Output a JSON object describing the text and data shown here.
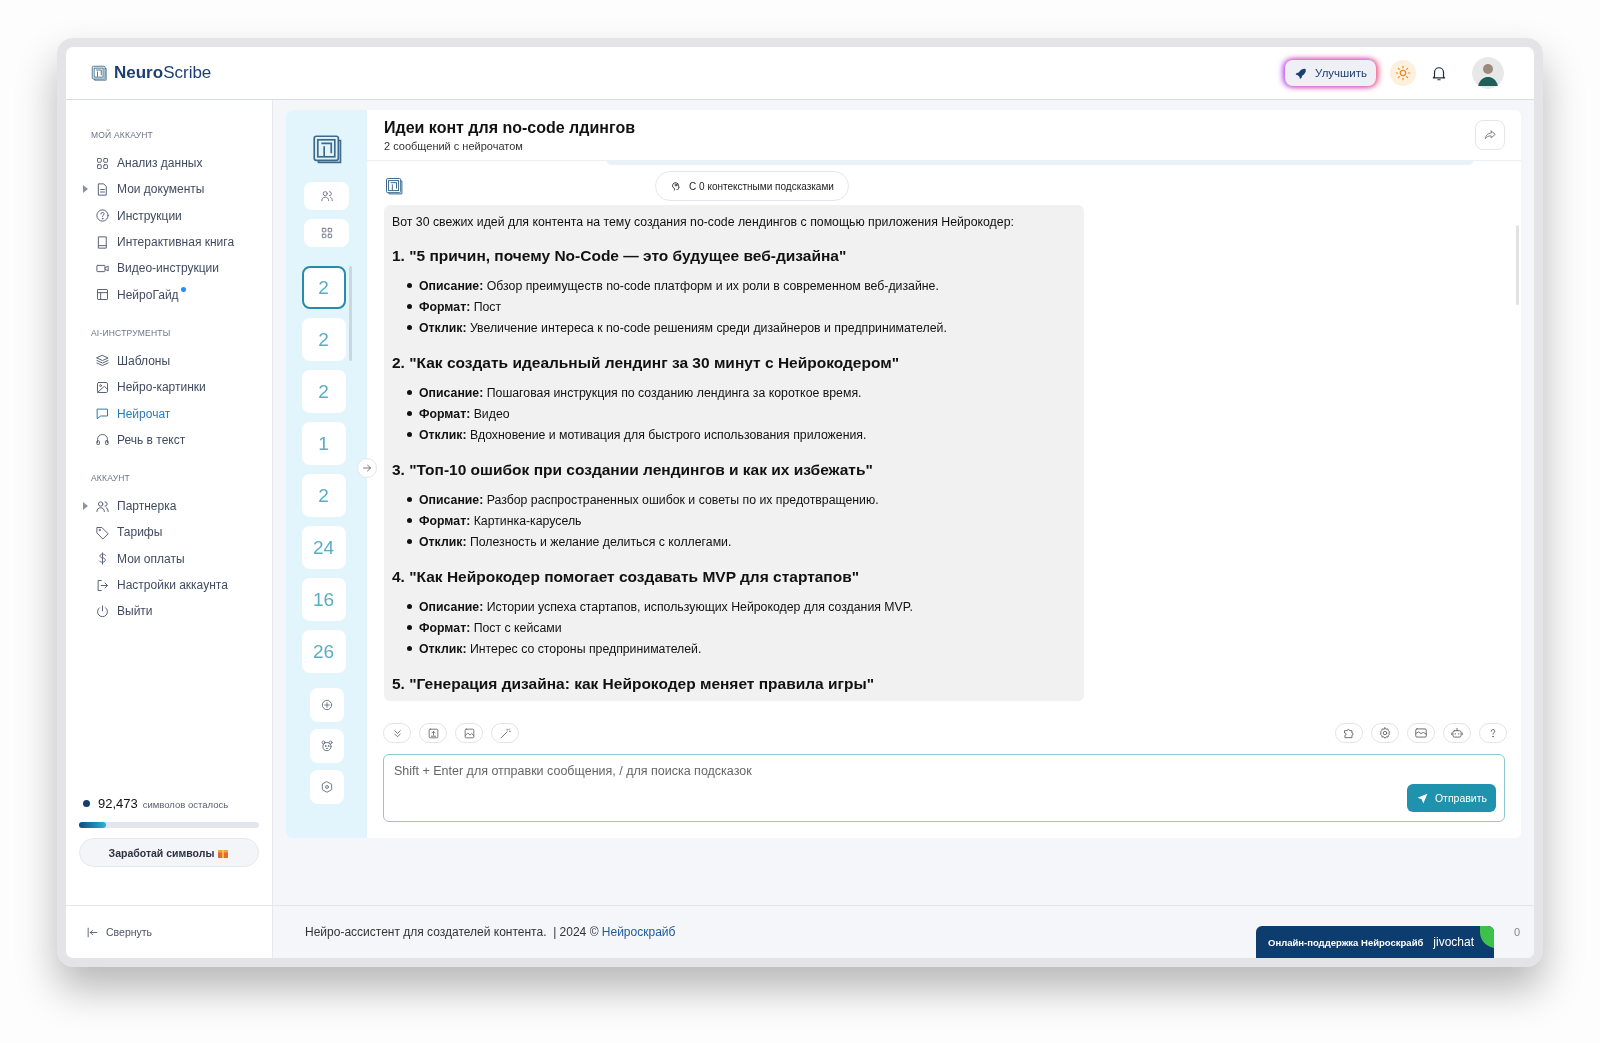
{
  "header": {
    "logo_bold": "Neuro",
    "logo_light": "Scribe",
    "upgrade_button": "Улучшить"
  },
  "sidebar": {
    "sections": [
      {
        "title": "МОЙ АККАУНТ",
        "items": [
          {
            "label": "Анализ данных",
            "expandable": false,
            "selected": false,
            "new_dot": false
          },
          {
            "label": "Мои документы",
            "expandable": true,
            "selected": false,
            "new_dot": false
          },
          {
            "label": "Инструкции",
            "expandable": false,
            "selected": false,
            "new_dot": false
          },
          {
            "label": "Интерактивная книга",
            "expandable": false,
            "selected": false,
            "new_dot": false
          },
          {
            "label": "Видео-инструкции",
            "expandable": false,
            "selected": false,
            "new_dot": false
          },
          {
            "label": "НейроГайд",
            "expandable": false,
            "selected": false,
            "new_dot": true
          }
        ]
      },
      {
        "title": "AI-ИНСТРУМЕНТЫ",
        "items": [
          {
            "label": "Шаблоны",
            "expandable": false,
            "selected": false,
            "new_dot": false
          },
          {
            "label": "Нейро-картинки",
            "expandable": false,
            "selected": false,
            "new_dot": false
          },
          {
            "label": "Нейрочат",
            "expandable": false,
            "selected": true,
            "new_dot": false
          },
          {
            "label": "Речь в текст",
            "expandable": false,
            "selected": false,
            "new_dot": false
          }
        ]
      },
      {
        "title": "АККАУНТ",
        "items": [
          {
            "label": "Партнерка",
            "expandable": true,
            "selected": false,
            "new_dot": false
          },
          {
            "label": "Тарифы",
            "expandable": false,
            "selected": false,
            "new_dot": false
          },
          {
            "label": "Мои оплаты",
            "expandable": false,
            "selected": false,
            "new_dot": false
          },
          {
            "label": "Настройки аккаунта",
            "expandable": false,
            "selected": false,
            "new_dot": false
          },
          {
            "label": "Выйти",
            "expandable": false,
            "selected": false,
            "new_dot": false
          }
        ]
      }
    ],
    "credits": {
      "count": "92,473",
      "label": "символов осталось",
      "level": 0.15
    },
    "earn_button": "Заработай символы",
    "collapse": "Свернуть"
  },
  "rail": {
    "chats": [
      {
        "count": "2",
        "selected": true
      },
      {
        "count": "2",
        "selected": false
      },
      {
        "count": "2",
        "selected": false
      },
      {
        "count": "1",
        "selected": false
      },
      {
        "count": "2",
        "selected": false
      },
      {
        "count": "24",
        "selected": false
      },
      {
        "count": "16",
        "selected": false
      },
      {
        "count": "26",
        "selected": false
      }
    ]
  },
  "chat": {
    "title": "Идеи конт для no-code лдингов",
    "subtitle": "2 сообщений с нейрочатом",
    "context_pill": "С 0 контекстными подсказками",
    "message": {
      "intro": "Вот 30 свежих идей для контента на тему создания no-code лендингов с помощью приложения Нейрокодер:",
      "sections": [
        {
          "heading": "1. \"5 причин, почему No-Code — это будущее веб-дизайна\"",
          "bullets": [
            "**Описание:** Обзор преимуществ no-code платформ и их роли в современном веб-дизайне.",
            "**Формат:** Пост",
            "**Отклик:** Увеличение интереса к no-code решениям среди дизайнеров и предпринимателей."
          ]
        },
        {
          "heading": "2. \"Как создать идеальный лендинг за 30 минут с Нейрокодером\"",
          "bullets": [
            "**Описание:** Пошаговая инструкция по созданию лендинга за короткое время.",
            "**Формат:** Видео",
            "**Отклик:** Вдохновение и мотивация для быстрого использования приложения."
          ]
        },
        {
          "heading": "3. \"Топ-10 ошибок при создании лендингов и как их избежать\"",
          "bullets": [
            "**Описание:** Разбор распространенных ошибок и советы по их предотвращению.",
            "**Формат:** Картинка-карусель",
            "**Отклик:** Полезность и желание делиться с коллегами."
          ]
        },
        {
          "heading": "4. \"Как Нейрокодер помогает создавать MVP для стартапов\"",
          "bullets": [
            "**Описание:** Истории успеха стартапов, использующих Нейрокодер для создания MVP.",
            "**Формат:** Пост с кейсами",
            "**Отклик:** Интерес со стороны предпринимателей."
          ]
        },
        {
          "heading": "5. \"Генерация дизайна: как Нейрокодер меняет правила игры\""
        }
      ]
    },
    "input": {
      "placeholder": "Shift + Enter для отправки сообщения, / для поиска подсказок"
    },
    "send_button": "Отправить"
  },
  "footer": {
    "text": "Нейро-ассистент для создателей контента.  | 2024 © ",
    "link": "Нейроскрайб",
    "counter": "0"
  },
  "support_widget": {
    "label": "Онлайн-поддержка Нейроскрайб",
    "brand": "jivochat"
  }
}
